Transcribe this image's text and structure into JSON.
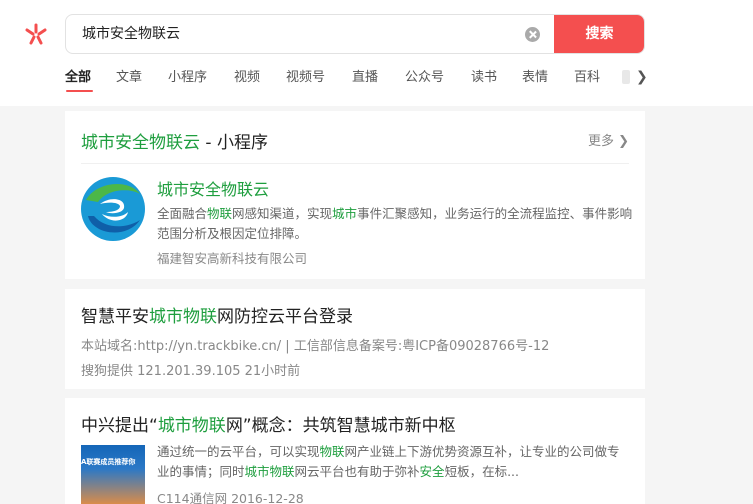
{
  "search": {
    "query": "城市安全物联云",
    "button_label": "搜索"
  },
  "tabs": [
    "全部",
    "文章",
    "小程序",
    "视频",
    "视频号",
    "直播",
    "公众号",
    "读书",
    "表情",
    "百科"
  ],
  "miniprogram_card": {
    "title_keyword": "城市安全物联云",
    "title_suffix": " - 小程序",
    "more_label": "更多",
    "app_name": "城市安全物联云",
    "desc_parts": [
      "全面融合",
      "物联",
      "网感知渠道，实现",
      "城市",
      "事件汇聚感知，业务运行的全流程监控、事件影响范围分析及根因定位排障。"
    ],
    "company": "福建智安高新科技有限公司"
  },
  "result_1": {
    "title_parts": [
      "智慧平安",
      "城市物联",
      "网防控云平台登录"
    ],
    "domain_line": "本站域名:http://yn.trackbike.cn/ | 工信部信息备案号:粤ICP备09028766号-12",
    "source_line": "搜狗提供 121.201.39.105  21小时前"
  },
  "result_2": {
    "title_parts": [
      "中兴提出“",
      "城市物联",
      "网”概念：共筑智慧城市新中枢"
    ],
    "image_text": "A联赛成员推荐你",
    "desc_parts": [
      "通过统一的云平台，可以实现",
      "物联",
      "网产业链上下游优势资源互补，让专业的公司做专业的事情；同时",
      "城市物联",
      "网云平台也有助于弥补",
      "安全",
      "短板，在标..."
    ],
    "source": "C114通信网",
    "date": "2016-12-28"
  },
  "colors": {
    "accent": "#f44f4f",
    "highlight": "#1e9e3e"
  }
}
